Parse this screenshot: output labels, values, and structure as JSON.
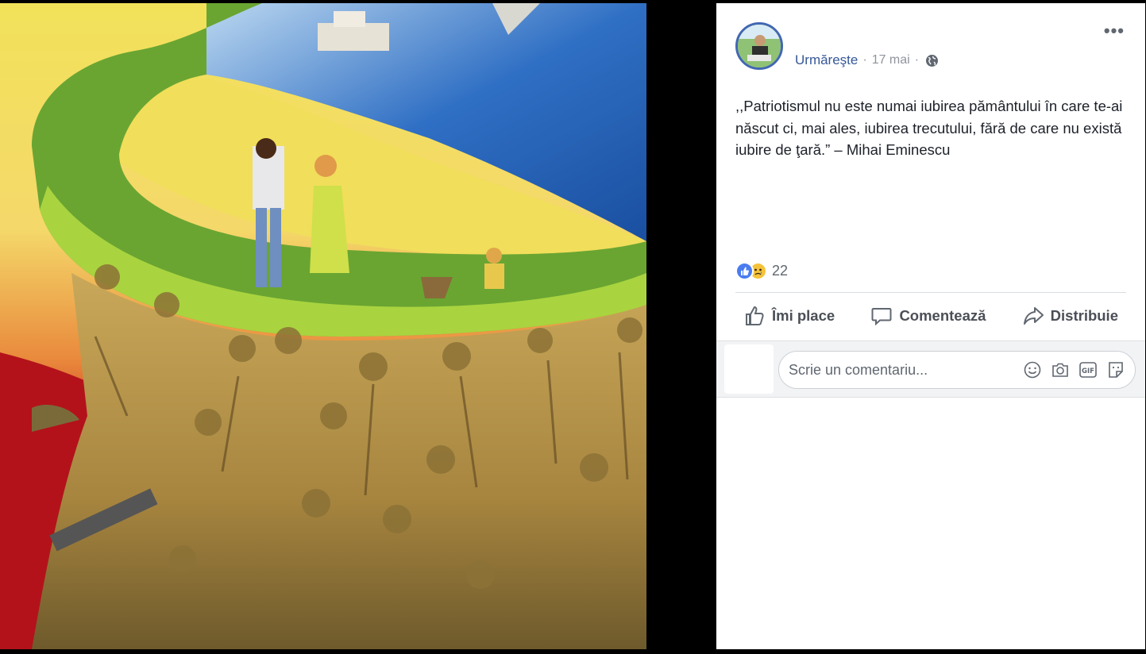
{
  "post": {
    "follow_label": "Urmăreşte",
    "separator": "·",
    "date": "17 mai",
    "privacy_icon": "globe-icon",
    "more_label": "•••",
    "text": ",,Patriotismul nu este numai iubirea pământului în care te-ai născut ci, mai ales, iubirea trecutului, fără de care nu există iubire de ţară.” – Mihai Eminescu",
    "reactions": {
      "icons": [
        "like-icon",
        "sad-icon"
      ],
      "count": "22"
    },
    "actions": {
      "like": "Îmi place",
      "comment": "Comentează",
      "share": "Distribuie"
    },
    "comment_box": {
      "placeholder": "Scrie un comentariu...",
      "icons": [
        "emoji-icon",
        "camera-icon",
        "gif-icon",
        "sticker-icon"
      ]
    }
  },
  "colors": {
    "link": "#365899",
    "meta": "#90949c",
    "action_text": "#4b4f56",
    "like_blue": "#4a7cf0",
    "sad_yellow": "#f5c33b"
  }
}
